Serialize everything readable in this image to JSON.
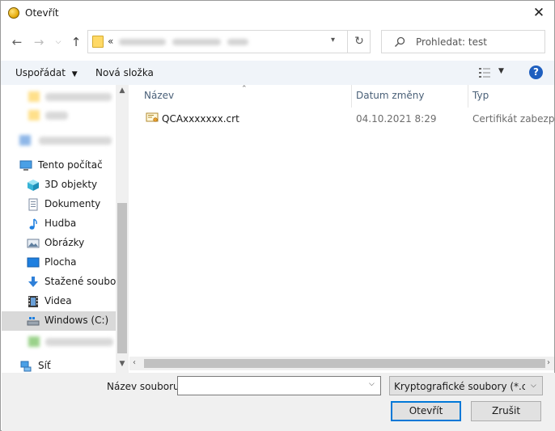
{
  "window": {
    "title": "Otevřít"
  },
  "address": {
    "overflow": "«"
  },
  "search": {
    "placeholder": "Prohledat: test"
  },
  "toolbar": {
    "organize_label": "Uspořádat",
    "new_folder_label": "Nová složka",
    "help_label": "?"
  },
  "nav": {
    "items": [
      {
        "label": "Tento počítač",
        "icon": "computer-icon"
      },
      {
        "label": "3D objekty",
        "icon": "3d-objects-icon"
      },
      {
        "label": "Dokumenty",
        "icon": "documents-icon"
      },
      {
        "label": "Hudba",
        "icon": "music-icon"
      },
      {
        "label": "Obrázky",
        "icon": "pictures-icon"
      },
      {
        "label": "Plocha",
        "icon": "desktop-icon"
      },
      {
        "label": "Stažené soubory",
        "icon": "downloads-icon"
      },
      {
        "label": "Videa",
        "icon": "videos-icon"
      },
      {
        "label": "Windows (C:)",
        "icon": "drive-icon"
      },
      {
        "label": "Síť",
        "icon": "network-icon"
      }
    ]
  },
  "filelist": {
    "columns": [
      "Název",
      "Datum změny",
      "Typ"
    ],
    "rows": [
      {
        "name": "QCAxxxxxxx.crt",
        "date": "04.10.2021 8:29",
        "type": "Certifikát zabezpe..."
      }
    ]
  },
  "bottom": {
    "filename_label": "Název souboru:",
    "filename_value": "",
    "filter_value": "Kryptografické soubory (*.crt;*.",
    "open_label": "Otevřít",
    "cancel_label": "Zrušit"
  },
  "colors": {
    "accent": "#0078d7",
    "toolbar_bg": "#f0f4f9",
    "selection": "#d9d9d9",
    "help": "#1f5fbf"
  }
}
